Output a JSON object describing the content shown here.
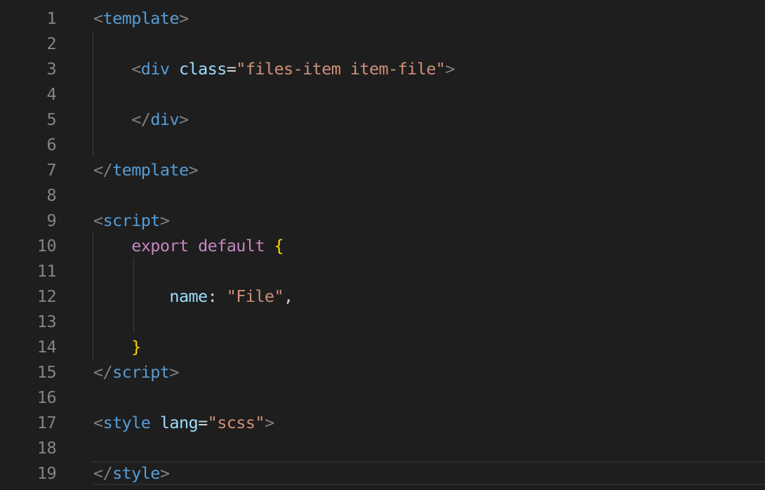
{
  "editor": {
    "language": "vue",
    "colors": {
      "background": "#1e1e1e",
      "line_number": "#858585",
      "tag_bracket": "#808080",
      "tag_name": "#569cd6",
      "attribute": "#9cdcfe",
      "string": "#ce9178",
      "keyword": "#c586c0",
      "brace": "#ffd700",
      "text": "#d4d4d4"
    },
    "lines": [
      {
        "number": "1",
        "tokens": [
          {
            "text": "<",
            "kind": "p"
          },
          {
            "text": "template",
            "kind": "t"
          },
          {
            "text": ">",
            "kind": "p"
          }
        ]
      },
      {
        "number": "2",
        "tokens": []
      },
      {
        "number": "3",
        "tokens": [
          {
            "text": "    ",
            "kind": "o"
          },
          {
            "text": "<",
            "kind": "p"
          },
          {
            "text": "div",
            "kind": "t"
          },
          {
            "text": " ",
            "kind": "o"
          },
          {
            "text": "class",
            "kind": "a"
          },
          {
            "text": "=",
            "kind": "o"
          },
          {
            "text": "\"files-item item-file\"",
            "kind": "s"
          },
          {
            "text": ">",
            "kind": "p"
          }
        ]
      },
      {
        "number": "4",
        "tokens": []
      },
      {
        "number": "5",
        "tokens": [
          {
            "text": "    ",
            "kind": "o"
          },
          {
            "text": "</",
            "kind": "p"
          },
          {
            "text": "div",
            "kind": "t"
          },
          {
            "text": ">",
            "kind": "p"
          }
        ]
      },
      {
        "number": "6",
        "tokens": []
      },
      {
        "number": "7",
        "tokens": [
          {
            "text": "</",
            "kind": "p"
          },
          {
            "text": "template",
            "kind": "t"
          },
          {
            "text": ">",
            "kind": "p"
          }
        ]
      },
      {
        "number": "8",
        "tokens": []
      },
      {
        "number": "9",
        "tokens": [
          {
            "text": "<",
            "kind": "p"
          },
          {
            "text": "script",
            "kind": "t"
          },
          {
            "text": ">",
            "kind": "p"
          }
        ]
      },
      {
        "number": "10",
        "tokens": [
          {
            "text": "    ",
            "kind": "o"
          },
          {
            "text": "export",
            "kind": "k"
          },
          {
            "text": " ",
            "kind": "o"
          },
          {
            "text": "default",
            "kind": "k"
          },
          {
            "text": " ",
            "kind": "o"
          },
          {
            "text": "{",
            "kind": "b"
          }
        ]
      },
      {
        "number": "11",
        "tokens": []
      },
      {
        "number": "12",
        "tokens": [
          {
            "text": "        ",
            "kind": "o"
          },
          {
            "text": "name",
            "kind": "a"
          },
          {
            "text": ": ",
            "kind": "o"
          },
          {
            "text": "\"File\"",
            "kind": "s"
          },
          {
            "text": ",",
            "kind": "o"
          }
        ]
      },
      {
        "number": "13",
        "tokens": []
      },
      {
        "number": "14",
        "tokens": [
          {
            "text": "    ",
            "kind": "o"
          },
          {
            "text": "}",
            "kind": "b"
          }
        ]
      },
      {
        "number": "15",
        "tokens": [
          {
            "text": "</",
            "kind": "p"
          },
          {
            "text": "script",
            "kind": "t"
          },
          {
            "text": ">",
            "kind": "p"
          }
        ]
      },
      {
        "number": "16",
        "tokens": []
      },
      {
        "number": "17",
        "tokens": [
          {
            "text": "<",
            "kind": "p"
          },
          {
            "text": "style",
            "kind": "t"
          },
          {
            "text": " ",
            "kind": "o"
          },
          {
            "text": "lang",
            "kind": "a"
          },
          {
            "text": "=",
            "kind": "o"
          },
          {
            "text": "\"scss\"",
            "kind": "s"
          },
          {
            "text": ">",
            "kind": "p"
          }
        ]
      },
      {
        "number": "18",
        "tokens": []
      },
      {
        "number": "19",
        "tokens": [
          {
            "text": "</",
            "kind": "p"
          },
          {
            "text": "style",
            "kind": "t"
          },
          {
            "text": ">",
            "kind": "p"
          }
        ]
      }
    ]
  }
}
